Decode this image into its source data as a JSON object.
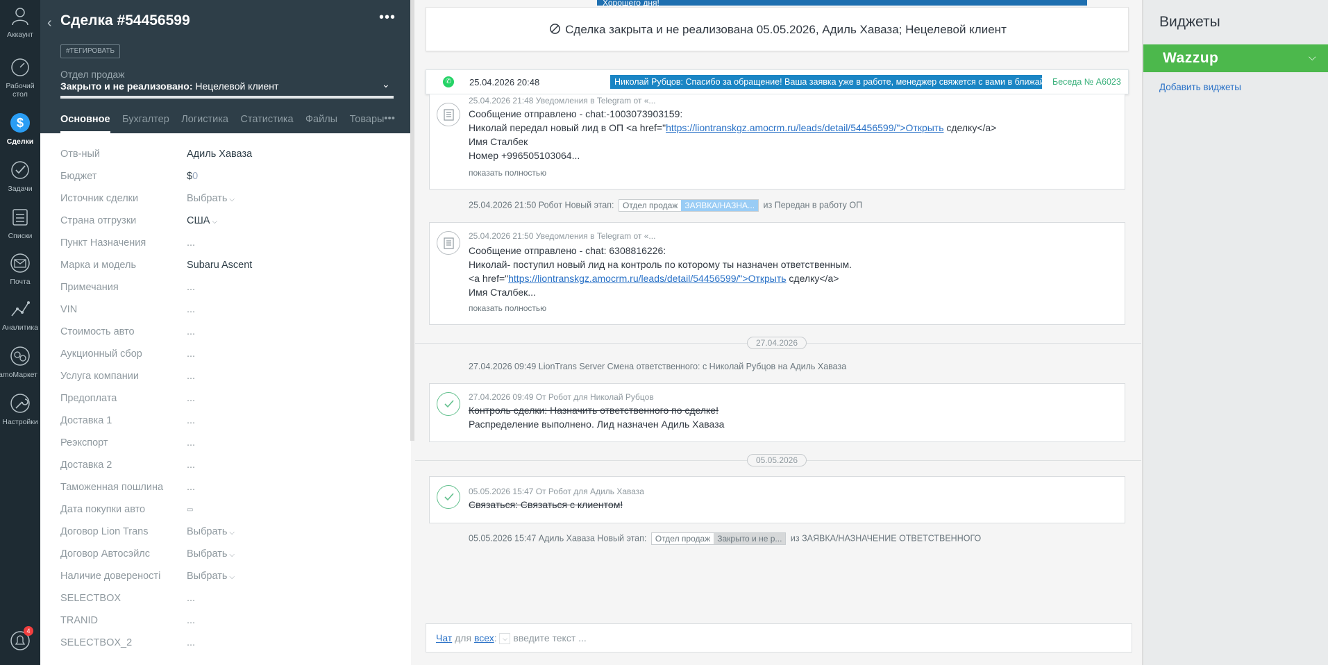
{
  "nav": {
    "items": [
      {
        "label": "Аккаунт"
      },
      {
        "label": "Рабочий стол"
      },
      {
        "label": "Сделки"
      },
      {
        "label": "Задачи"
      },
      {
        "label": "Списки"
      },
      {
        "label": "Почта"
      },
      {
        "label": "Аналитика"
      },
      {
        "label": "amoМаркет"
      },
      {
        "label": "Настройки"
      }
    ],
    "notifications_count": "4"
  },
  "card": {
    "title": "Сделка #54456599",
    "more": "•••",
    "tag_button": "#ТЕГИРОВАТЬ",
    "pipeline": "Отдел продаж",
    "status_prefix": "Закрыто и не реализовано:",
    "status_reason": " Нецелевой клиент",
    "tabs": [
      "Основное",
      "Бухгалтер",
      "Логистика",
      "Статистика",
      "Файлы",
      "Товары"
    ],
    "tabs_more": "•••",
    "fields": [
      {
        "name": "Отв-ный",
        "value": "Адиль Хаваза"
      },
      {
        "name": "Бюджет",
        "value": "$0"
      },
      {
        "name": "Источник сделки",
        "value": "Выбрать"
      },
      {
        "name": "Страна отгрузки",
        "value": "США"
      },
      {
        "name": "Пункт Назначения",
        "value": "..."
      },
      {
        "name": "Марка и модель",
        "value": "Subaru Ascent"
      },
      {
        "name": "Примечания",
        "value": "..."
      },
      {
        "name": "VIN",
        "value": "..."
      },
      {
        "name": "Стоимость авто",
        "value": "..."
      },
      {
        "name": "Аукционный сбор",
        "value": "..."
      },
      {
        "name": "Услуга компании",
        "value": "..."
      },
      {
        "name": "Предоплата",
        "value": "..."
      },
      {
        "name": "Доставка 1",
        "value": "..."
      },
      {
        "name": "Реэкспорт",
        "value": "..."
      },
      {
        "name": "Доставка 2",
        "value": "..."
      },
      {
        "name": "Таможенная пошлина",
        "value": "..."
      },
      {
        "name": "Дата покупки авто",
        "value": "▭"
      },
      {
        "name": "Договор Lion Trans",
        "value": "Выбрать"
      },
      {
        "name": "Договор Автосэйлс",
        "value": "Выбрать"
      },
      {
        "name": "Наличие довереності",
        "value": "Выбрать"
      },
      {
        "name": "SELECTBOX",
        "value": "..."
      },
      {
        "name": "TRANID",
        "value": "..."
      },
      {
        "name": "SELECTBOX_2",
        "value": "..."
      }
    ],
    "currency": "$",
    "budget_amount": "0"
  },
  "feed": {
    "top_bar_text": "Хорошего дня!",
    "closed_banner": "Сделка закрыта и не реализована 05.05.2026, Адиль Хаваза; Нецелевой клиент",
    "chat": {
      "date": "25.04.2026 20:48",
      "message": "Николай Рубцов: Спасибо за обращение! Ваша заявка уже в работе, менеджер свяжется с вами в ближай...",
      "conversation": "Беседа № А6023"
    },
    "note1": {
      "head": "25.04.2026 21:48 Уведомления в Telegram от «...",
      "line1": "Сообщение отправлено - chat:-1003073903159:",
      "line2_pre": "Николай передал новый лид в ОП <a href=\"",
      "line2_link": "https://liontranskgz.amocrm.ru/leads/detail/54456599/\">Открыть",
      "line2_post": " сделку</a>",
      "line3": "Имя Сталбек",
      "line4": "Номер +996505103064...",
      "more": "показать полностью"
    },
    "event1": {
      "text": "25.04.2026 21:50 Робот Новый этап:",
      "pill_a": "Отдел продаж",
      "pill_b": "ЗАЯВКА/НАЗНА...",
      "tail": "из Передан в работу ОП"
    },
    "note2": {
      "head": "25.04.2026 21:50 Уведомления в Telegram от «...",
      "line1": "Сообщение отправлено - chat: 6308816226:",
      "line2": "Николай- поступил новый лид на контроль по которому ты назначен ответственным.",
      "line3_pre": "<a href=\"",
      "line3_link": "https://liontranskgz.amocrm.ru/leads/detail/54456599/\">Открыть",
      "line3_post": " сделку</a>",
      "line4": "Имя Сталбек...",
      "more": "показать полностью"
    },
    "date_sep1": "27.04.2026",
    "event2": "27.04.2026 09:49 LionTrans Server Смена ответственного: с Николай Рубцов на Адиль Хаваза",
    "task1": {
      "head": "27.04.2026 09:49  От Робот для Николай Рубцов",
      "line1": "Контроль сделки: Назначить ответственного по сделке!",
      "line2": "Распределение выполнено. Лид назначен Адиль Хаваза"
    },
    "date_sep2": "05.05.2026",
    "task2": {
      "head": "05.05.2026 15:47  От Робот для Адиль Хаваза",
      "line1": "Связаться: Связаться с клиентом!"
    },
    "event3": {
      "text": "05.05.2026 15:47 Адиль Хаваза Новый этап:",
      "pill_a": "Отдел продаж",
      "pill_b": "Закрыто и не р...",
      "tail": "из ЗАЯВКА/НАЗНАЧЕНИЕ ОТВЕТСТВЕННОГО"
    },
    "compose": {
      "chat": "Чат",
      "for": "для",
      "all": "всех",
      "colon": ":",
      "placeholder": "введите текст ..."
    }
  },
  "widgets": {
    "title": "Виджеты",
    "wazzup": "Wazzup",
    "add": "Добавить виджеты"
  },
  "colors": {
    "nav_bg": "#1e2b33",
    "card_head_bg": "#2e3e48",
    "wazzup_green": "#4cb84c",
    "link_blue": "#2a72c7",
    "chat_blue": "#1a85c4"
  }
}
